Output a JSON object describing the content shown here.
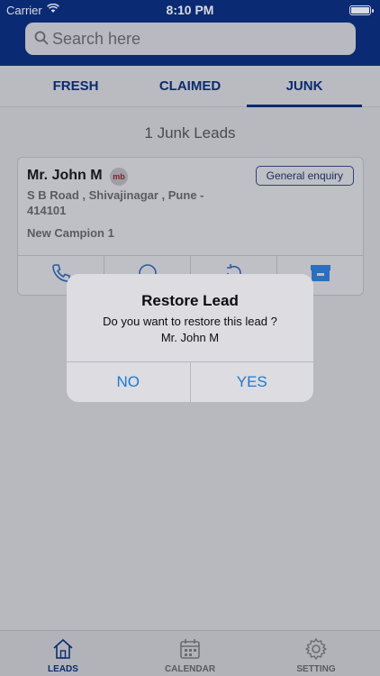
{
  "status_bar": {
    "carrier": "Carrier",
    "time": "8:10 PM"
  },
  "search": {
    "placeholder": "Search here"
  },
  "tabs": [
    {
      "label": "FRESH",
      "active": false
    },
    {
      "label": "CLAIMED",
      "active": false
    },
    {
      "label": "JUNK",
      "active": true
    }
  ],
  "leads_count_text": "1 Junk Leads",
  "lead": {
    "name": "Mr. John M",
    "source_badge": "mb",
    "category": "General enquiry",
    "address": "S B Road , Shivajinagar , Pune - 414101",
    "campaign": "New Campion 1",
    "actions": [
      "phone-icon",
      "whatsapp-icon",
      "restore-icon",
      "archive-icon"
    ]
  },
  "dialog": {
    "title": "Restore Lead",
    "message": "Do you want to restore this lead ?",
    "lead_name": "Mr. John M",
    "no_label": "NO",
    "yes_label": "YES"
  },
  "bottom_nav": [
    {
      "label": "LEADS",
      "icon": "home-icon",
      "active": true
    },
    {
      "label": "CALENDAR",
      "icon": "calendar-icon",
      "active": false
    },
    {
      "label": "SETTING",
      "icon": "gear-icon",
      "active": false
    }
  ],
  "colors": {
    "brand": "#0a2a73",
    "accent": "#1a7ad4"
  }
}
